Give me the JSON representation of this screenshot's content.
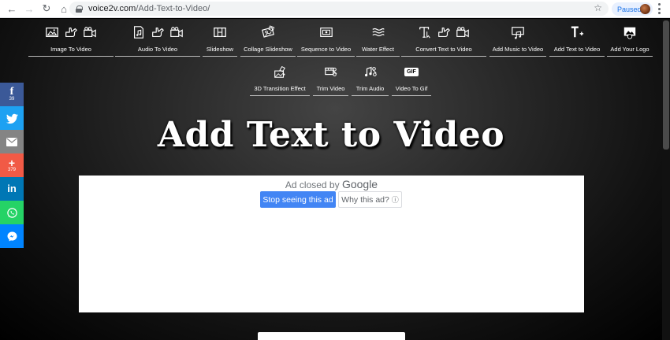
{
  "browser": {
    "url_host": "voice2v.com",
    "url_path": "/Add-Text-to-Video/",
    "profile_label": "Paused"
  },
  "nav": {
    "row1": [
      {
        "label": "Image To Video"
      },
      {
        "label": "Audio To Video"
      },
      {
        "label": "Slideshow"
      },
      {
        "label": "Collage Slideshow"
      },
      {
        "label": "Sequence to Video"
      },
      {
        "label": "Water Effect"
      },
      {
        "label": "Convert Text to Video"
      },
      {
        "label": "Add Music to Video"
      },
      {
        "label": "Add Text to Video"
      },
      {
        "label": "Add Your Logo"
      }
    ],
    "row2": [
      {
        "label": "3D Transition Effect"
      },
      {
        "label": "Trim Video"
      },
      {
        "label": "Trim Audio"
      },
      {
        "label": "Video To Gif"
      }
    ]
  },
  "page_title": "Add Text to Video",
  "ad": {
    "closed_text": "Ad closed by",
    "brand": "Google",
    "stop_label": "Stop seeing this ad",
    "why_label": "Why this ad?",
    "why_icon": "ⓘ"
  },
  "share": [
    {
      "network": "facebook",
      "glyph": "f",
      "count": "39",
      "color": "#3b5998"
    },
    {
      "network": "twitter",
      "glyph": "",
      "count": "",
      "color": "#1da1f2"
    },
    {
      "network": "email",
      "glyph": "",
      "count": "",
      "color": "#848484"
    },
    {
      "network": "more",
      "glyph": "+",
      "count": "379",
      "color": "#f15a46"
    },
    {
      "network": "linkedin",
      "glyph": "in",
      "count": "",
      "color": "#0077b5"
    },
    {
      "network": "whatsapp",
      "glyph": "",
      "count": "",
      "color": "#25d366"
    },
    {
      "network": "messenger",
      "glyph": "",
      "count": "",
      "color": "#0084ff"
    }
  ],
  "gif_badge": "GIF"
}
